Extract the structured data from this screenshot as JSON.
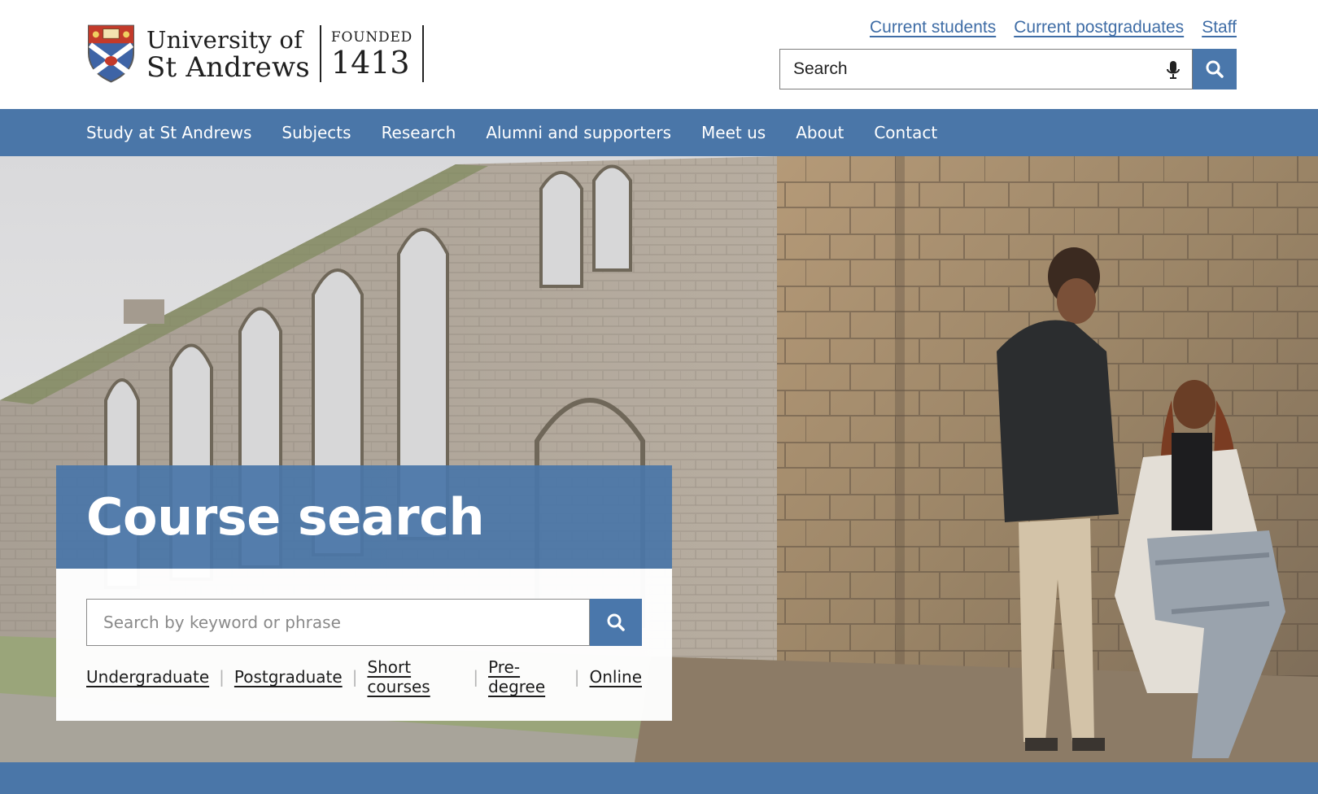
{
  "brand": {
    "university_line1": "University of",
    "university_line2": "St Andrews",
    "founded_label": "FOUNDED",
    "founded_year": "1413",
    "crest_icon": "university-crest-icon"
  },
  "top_links": [
    {
      "label": "Current students"
    },
    {
      "label": "Current postgraduates"
    },
    {
      "label": "Staff"
    }
  ],
  "site_search": {
    "placeholder": "Search",
    "mic_icon": "microphone-icon",
    "button_icon": "search-icon"
  },
  "nav": {
    "items": [
      {
        "label": "Study at St Andrews"
      },
      {
        "label": "Subjects"
      },
      {
        "label": "Research"
      },
      {
        "label": "Alumni and supporters"
      },
      {
        "label": "Meet us"
      },
      {
        "label": "About"
      },
      {
        "label": "Contact"
      }
    ]
  },
  "course_search": {
    "title": "Course search",
    "placeholder": "Search by keyword or phrase",
    "button_icon": "search-icon",
    "links": [
      {
        "label": "Undergraduate"
      },
      {
        "label": "Postgraduate"
      },
      {
        "label": "Short courses"
      },
      {
        "label": "Pre-degree"
      },
      {
        "label": "Online"
      }
    ]
  },
  "colors": {
    "brand_blue": "#4a76a8",
    "link_blue": "#3f6da6",
    "white": "#ffffff"
  }
}
